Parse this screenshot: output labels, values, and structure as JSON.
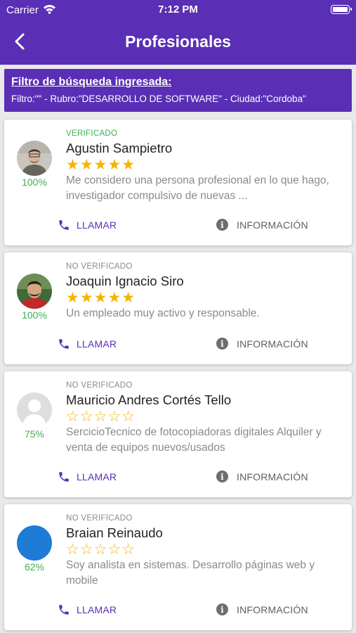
{
  "statusbar": {
    "carrier": "Carrier",
    "time": "7:12 PM"
  },
  "appbar": {
    "title": "Profesionales"
  },
  "filter": {
    "title": "Filtro de búsqueda ingresada:",
    "text": "Filtro:\"\" - Rubro:\"DESARROLLO DE SOFTWARE\" - Ciudad:\"Cordoba\""
  },
  "actions": {
    "call_label": "LLAMAR",
    "info_label": "INFORMACIÓN"
  },
  "professionals": [
    {
      "status": "VERIFICADO",
      "name": "Agustin Sampietro",
      "rating": 5,
      "stars": "★★★★★",
      "description": "Me considero una persona profesional en lo que hago, investigador compulsivo de nuevas ...",
      "percent": "100%"
    },
    {
      "status": "NO VERIFICADO",
      "name": "Joaquin Ignacio Siro",
      "rating": 5,
      "stars": "★★★★★",
      "description": "Un empleado muy activo y responsable.",
      "percent": "100%"
    },
    {
      "status": "NO VERIFICADO",
      "name": "Mauricio Andres Cortés Tello",
      "rating": 0,
      "stars": "☆☆☆☆☆",
      "description": "SercicioTecnico de fotocopiadoras digitales Alquiler y venta de equipos nuevos/usados",
      "percent": "75%"
    },
    {
      "status": "NO VERIFICADO",
      "name": "Braian Reinaudo",
      "rating": 0,
      "stars": "☆☆☆☆☆",
      "description": "Soy analista en sistemas. Desarrollo páginas web y mobile",
      "percent": "62%"
    }
  ],
  "colors": {
    "brand": "#5a2fb5",
    "verified": "#3eaf51",
    "star": "#f4b400"
  }
}
